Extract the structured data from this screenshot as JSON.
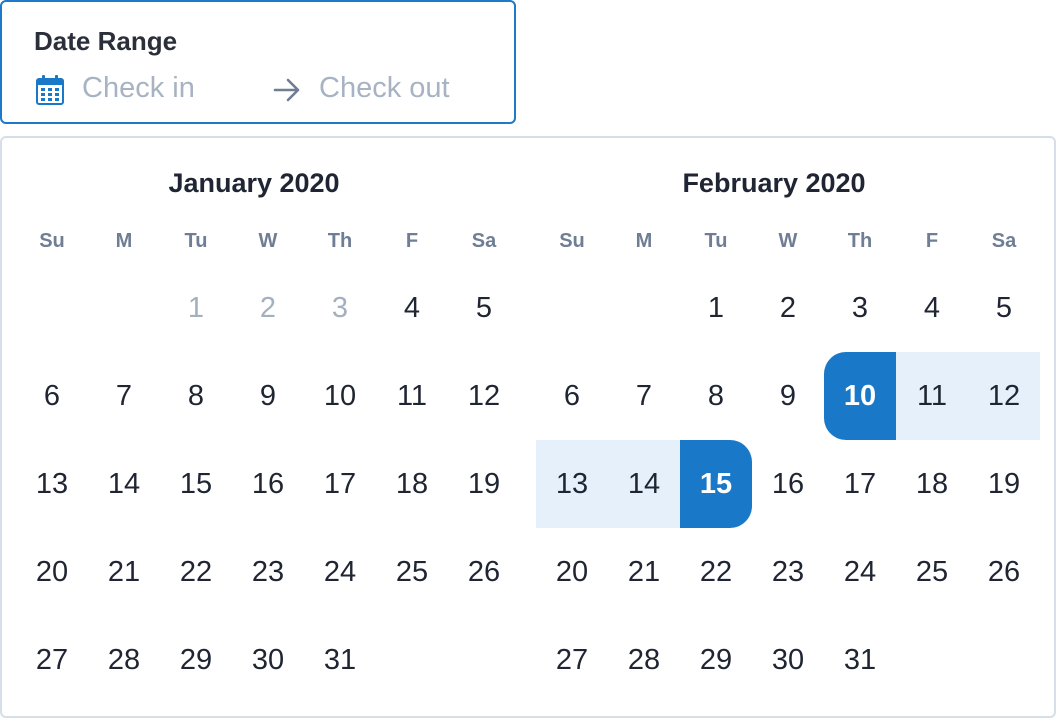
{
  "range": {
    "label": "Date Range",
    "checkin_placeholder": "Check in",
    "checkout_placeholder": "Check out"
  },
  "icons": {
    "calendar": "calendar-icon",
    "arrow": "arrow-right-icon"
  },
  "colors": {
    "accent": "#1978c8",
    "range_fill": "#e6f0fa",
    "placeholder": "#a7b3c2",
    "disabled_day": "#a3b0c0"
  },
  "calendars": [
    {
      "title": "January 2020",
      "weekdays": [
        "Su",
        "M",
        "Tu",
        "W",
        "Th",
        "F",
        "Sa"
      ],
      "days": [
        {
          "label": ""
        },
        {
          "label": ""
        },
        {
          "label": "1",
          "state": "disabled"
        },
        {
          "label": "2",
          "state": "disabled"
        },
        {
          "label": "3",
          "state": "disabled"
        },
        {
          "label": "4"
        },
        {
          "label": "5"
        },
        {
          "label": "6"
        },
        {
          "label": "7"
        },
        {
          "label": "8"
        },
        {
          "label": "9"
        },
        {
          "label": "10"
        },
        {
          "label": "11"
        },
        {
          "label": "12"
        },
        {
          "label": "13"
        },
        {
          "label": "14"
        },
        {
          "label": "15"
        },
        {
          "label": "16"
        },
        {
          "label": "17"
        },
        {
          "label": "18"
        },
        {
          "label": "19"
        },
        {
          "label": "20"
        },
        {
          "label": "21"
        },
        {
          "label": "22"
        },
        {
          "label": "23"
        },
        {
          "label": "24"
        },
        {
          "label": "25"
        },
        {
          "label": "26"
        },
        {
          "label": "27"
        },
        {
          "label": "28"
        },
        {
          "label": "29"
        },
        {
          "label": "30"
        },
        {
          "label": "31"
        }
      ]
    },
    {
      "title": "February 2020",
      "weekdays": [
        "Su",
        "M",
        "Tu",
        "W",
        "Th",
        "F",
        "Sa"
      ],
      "days": [
        {
          "label": ""
        },
        {
          "label": ""
        },
        {
          "label": "1"
        },
        {
          "label": "2"
        },
        {
          "label": "3"
        },
        {
          "label": "4"
        },
        {
          "label": "5"
        },
        {
          "label": "6"
        },
        {
          "label": "7"
        },
        {
          "label": "8"
        },
        {
          "label": "9"
        },
        {
          "label": "10",
          "state": "sel-start"
        },
        {
          "label": "11",
          "state": "in-range"
        },
        {
          "label": "12",
          "state": "in-range"
        },
        {
          "label": "13",
          "state": "in-range"
        },
        {
          "label": "14",
          "state": "in-range"
        },
        {
          "label": "15",
          "state": "sel-end"
        },
        {
          "label": "16"
        },
        {
          "label": "17"
        },
        {
          "label": "18"
        },
        {
          "label": "19"
        },
        {
          "label": "20"
        },
        {
          "label": "21"
        },
        {
          "label": "22"
        },
        {
          "label": "23"
        },
        {
          "label": "24"
        },
        {
          "label": "25"
        },
        {
          "label": "26"
        },
        {
          "label": "27"
        },
        {
          "label": "28"
        },
        {
          "label": "29"
        },
        {
          "label": "30"
        },
        {
          "label": "31"
        }
      ]
    }
  ]
}
